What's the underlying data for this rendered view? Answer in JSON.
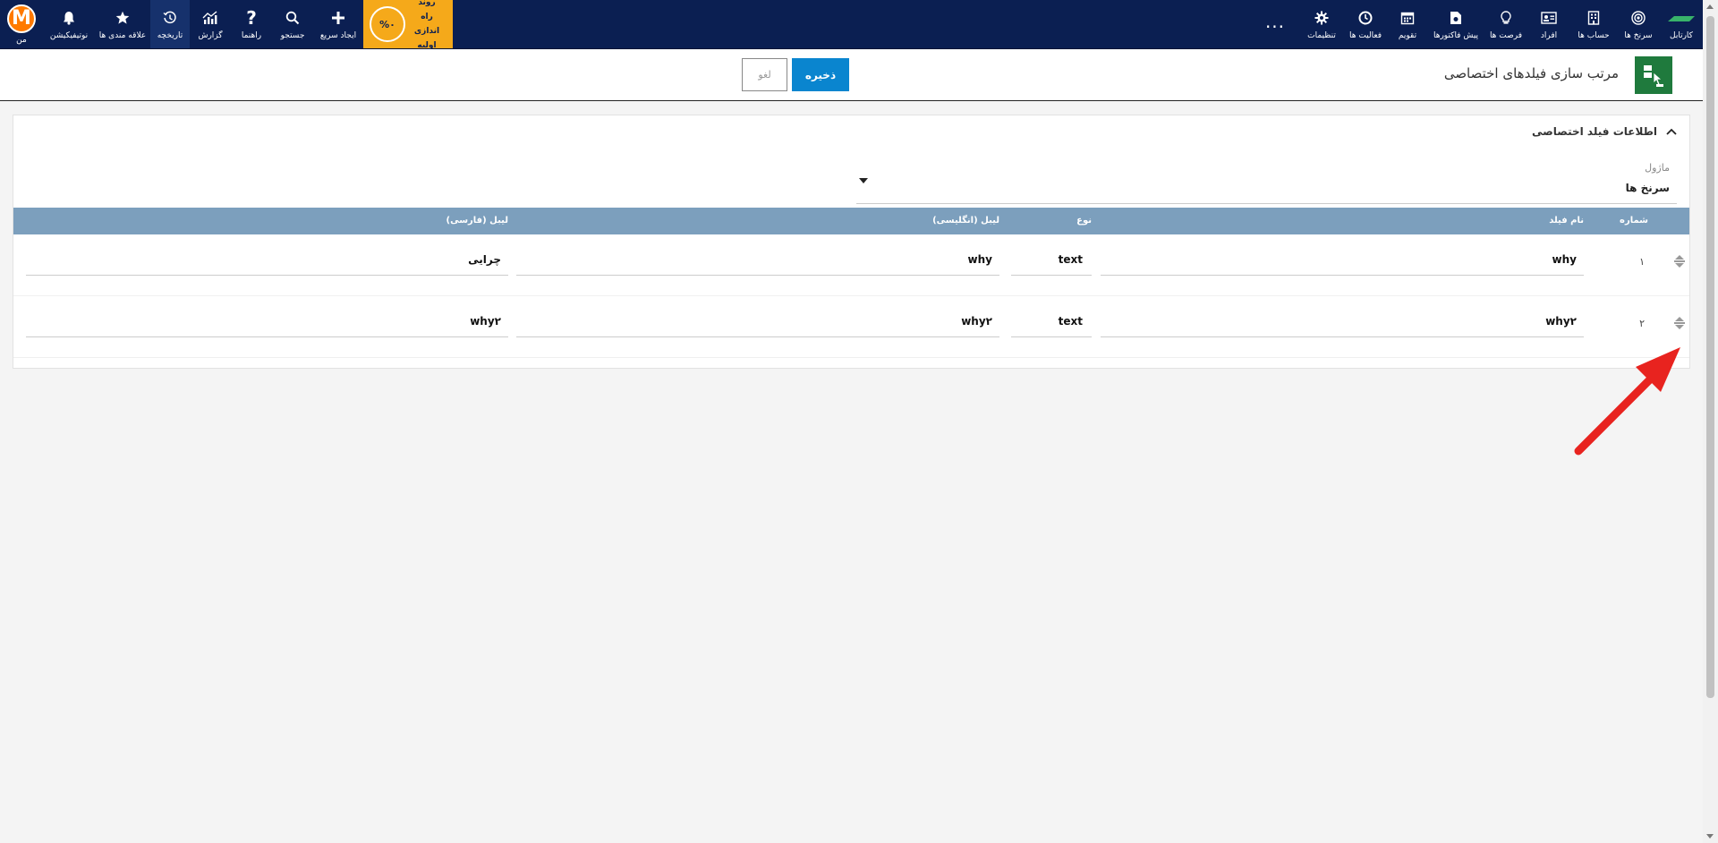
{
  "navbar": {
    "right_items": [
      {
        "name": "kartabl",
        "label": "کارتابل",
        "icon": "kartabl-logo-icon"
      },
      {
        "name": "leads",
        "label": "سرنخ ها",
        "icon": "target-icon"
      },
      {
        "name": "accounts",
        "label": "حساب ها",
        "icon": "building-icon"
      },
      {
        "name": "persons",
        "label": "افراد",
        "icon": "contact-card-icon"
      },
      {
        "name": "opportunities",
        "label": "فرصت ها",
        "icon": "lightbulb-icon"
      },
      {
        "name": "quotes",
        "label": "پیش فاکتورها",
        "icon": "invoice-icon"
      },
      {
        "name": "calendar",
        "label": "تقویم",
        "icon": "calendar-icon"
      },
      {
        "name": "activities",
        "label": "فعالیت ها",
        "icon": "clock-icon"
      },
      {
        "name": "settings",
        "label": "تنظیمات",
        "icon": "gear-icon"
      }
    ],
    "more_label": "...",
    "setup": {
      "percent": "%۰",
      "line1": "روند",
      "line2": "راه اندازی",
      "line3": "اولیه"
    },
    "left_items": [
      {
        "name": "quick-create",
        "label": "ایجاد سریع",
        "icon": "plus-icon"
      },
      {
        "name": "search",
        "label": "جستجو",
        "icon": "search-icon"
      },
      {
        "name": "help",
        "label": "راهنما",
        "icon": "question-icon"
      },
      {
        "name": "report",
        "label": "گزارش",
        "icon": "chart-icon"
      },
      {
        "name": "history",
        "label": "تاریخچه",
        "icon": "history-icon",
        "active": true
      },
      {
        "name": "favorites",
        "label": "علاقه مندی ها",
        "icon": "star-icon"
      },
      {
        "name": "notifications",
        "label": "نوتیفیکیشن",
        "icon": "bell-icon"
      },
      {
        "name": "me",
        "label": "من",
        "icon": "avatar-m"
      }
    ],
    "avatar_letter": "M"
  },
  "page": {
    "title": "مرتب سازی فیلدهای اختصاصی",
    "save_label": "ذخیره",
    "cancel_label": "لغو"
  },
  "panel": {
    "header": "اطلاعات فیلد اختصاصی",
    "module_label": "ماژول",
    "module_value": "سرنخ ها"
  },
  "table": {
    "columns": {
      "number": "شماره",
      "field_name": "نام فیلد",
      "type": "نوع",
      "label_en": "لیبل (انگلیسی)",
      "label_fa": "لیبل (فارسی)"
    },
    "rows": [
      {
        "number": "۱",
        "field_name": "why",
        "type": "text",
        "label_en": "why",
        "label_fa": "چرایی"
      },
      {
        "number": "۲",
        "field_name": "why۲",
        "type": "text",
        "label_en": "why۲",
        "label_fa": "why۲"
      }
    ]
  },
  "colors": {
    "navbar": "#0b1f52",
    "setup": "#f5a91a",
    "save_button": "#0a85cf",
    "table_header": "#7c9fbd",
    "annotation_arrow": "#e8231f"
  }
}
